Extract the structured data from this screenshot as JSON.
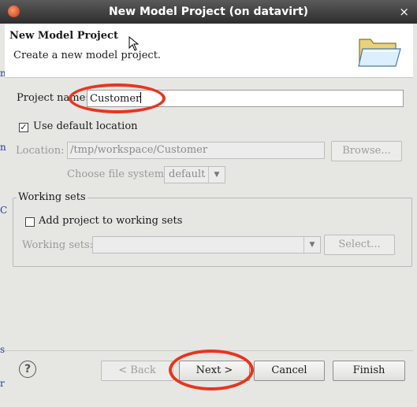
{
  "window": {
    "title": "New Model Project  (on datavirt)",
    "close_glyph": "×"
  },
  "header": {
    "title": "New Model Project",
    "description": "Create a new model project."
  },
  "form": {
    "project_name_label": "Project name:",
    "project_name_value": "Customer",
    "use_default_location_label": "Use default location",
    "use_default_location_checked": true,
    "location_label": "Location:",
    "location_value": "/tmp/workspace/Customer",
    "browse_label": "Browse...",
    "file_system_label": "Choose file system:",
    "file_system_value": "default"
  },
  "working_sets": {
    "group_title": "Working sets",
    "add_label": "Add project to working sets",
    "add_checked": false,
    "sets_label": "Working sets:",
    "sets_value": "",
    "select_label": "Select..."
  },
  "buttons": {
    "help": "?",
    "back": "< Back",
    "next": "Next >",
    "cancel": "Cancel",
    "finish": "Finish"
  },
  "colors": {
    "annotation": "#e8351e",
    "titlebar": "#3a3a3a",
    "dialog_bg": "#e6e6e3"
  }
}
